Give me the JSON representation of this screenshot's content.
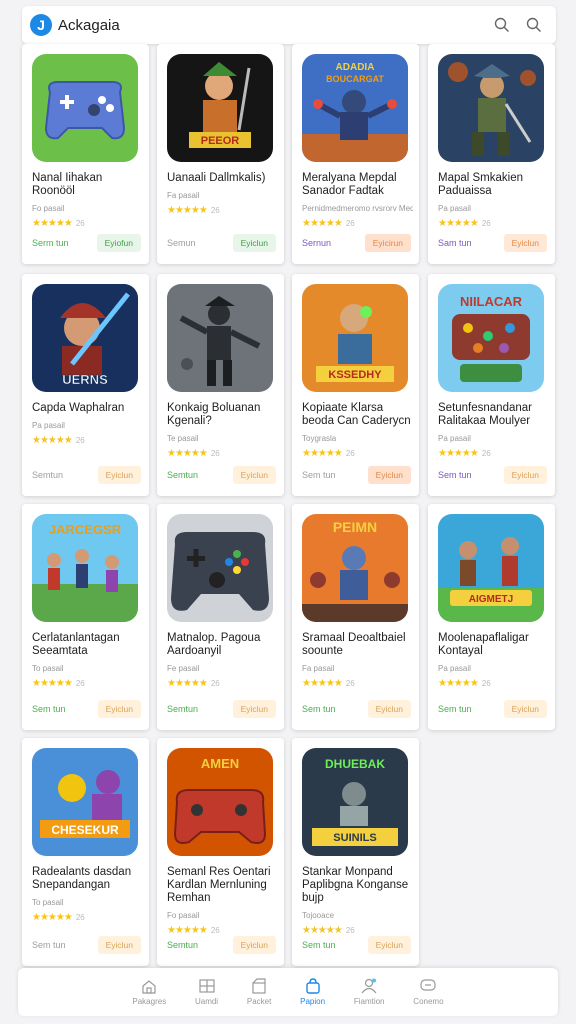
{
  "app": {
    "title": "Ackagaia"
  },
  "header": {
    "icons": [
      "search-icon",
      "search-icon"
    ]
  },
  "games": [
    {
      "name": "Nanal Iihakan Roonööl",
      "dev": "Fo pasail",
      "stars": "★★★★★",
      "count": "26",
      "left": "Serm tun",
      "right": "Eyiofun",
      "left_color": "#4caf50",
      "right_bg": "#e8f5e9",
      "right_color": "#43a047",
      "art": "controller-green"
    },
    {
      "name": "Uanaali Dallmkalis)",
      "dev": "Fa pasail",
      "stars": "★★★★★",
      "count": "26",
      "left": "Semun",
      "right": "Eyiclun",
      "left_color": "#9e9e9e",
      "right_bg": "#e8f5e9",
      "right_color": "#43a047",
      "art": "hero-dark"
    },
    {
      "name": "Meralyana Mepdal Sanador Fadtak",
      "dev": "Pernidmedmeromo rvsrorv Medrag",
      "stars": "★★★★★",
      "count": "26",
      "left": "Sernun",
      "right": "Eyicirun",
      "left_color": "#7e57c2",
      "right_bg": "#ffe0cc",
      "right_color": "#e08a4a",
      "art": "robot-battle"
    },
    {
      "name": "Mapal Smkakien Paduaissa",
      "dev": "Pa pasail",
      "stars": "★★★★★",
      "count": "26",
      "left": "Sam tun",
      "right": "Eyiclun",
      "left_color": "#7e57c2",
      "right_bg": "#ffe8d6",
      "right_color": "#e08a4a",
      "art": "warrior-blue"
    },
    {
      "name": "Capda Waphalran",
      "dev": "Pa pasail",
      "stars": "★★★★★",
      "count": "26",
      "left": "Semtun",
      "right": "Eyiclun",
      "left_color": "#9e9e9e",
      "right_bg": "#fff1dc",
      "right_color": "#d9a35a",
      "art": "knight-red"
    },
    {
      "name": "Konkaig Boluanan Kgenali?",
      "dev": "Te pasail",
      "stars": "★★★★★",
      "count": "26",
      "left": "Semtun",
      "right": "Eyiclun",
      "left_color": "#4caf50",
      "right_bg": "#fff1dc",
      "right_color": "#d9a35a",
      "art": "ninja-gray"
    },
    {
      "name": "Kopiaate Klarsa beoda Can Caderycn",
      "dev": "Toygrasla",
      "stars": "★★★★★",
      "count": "26",
      "left": "Sem tun",
      "right": "Eyiclun",
      "left_color": "#9e9e9e",
      "right_bg": "#ffe0cc",
      "right_color": "#e08a4a",
      "art": "hero-orange"
    },
    {
      "name": "Setunfesnandanar Ralitakaa Moulyer",
      "dev": "Pa pasail",
      "stars": "★★★★★",
      "count": "26",
      "left": "Sem tun",
      "right": "Eyiclun",
      "left_color": "#7e57c2",
      "right_bg": "#fff1dc",
      "right_color": "#d9a35a",
      "art": "board-blue"
    },
    {
      "name": "Cerlatanlantagan Seeamtata",
      "dev": "To pasail",
      "stars": "★★★★★",
      "count": "26",
      "left": "Sem tun",
      "right": "Eyiclun",
      "left_color": "#4caf50",
      "right_bg": "#fff1dc",
      "right_color": "#d9a35a",
      "art": "crowd-field"
    },
    {
      "name": "Matnalop. Pagoua Aardoanyil",
      "dev": "Fe pasail",
      "stars": "★★★★★",
      "count": "26",
      "left": "Semtun",
      "right": "Eyiclun",
      "left_color": "#4caf50",
      "right_bg": "#fff1dc",
      "right_color": "#d9a35a",
      "art": "controller-dark"
    },
    {
      "name": "Sramaal Deoaltbaiel soounte",
      "dev": "Fa pasail",
      "stars": "★★★★★",
      "count": "26",
      "left": "Sem tun",
      "right": "Eyiclun",
      "left_color": "#4caf50",
      "right_bg": "#fff1dc",
      "right_color": "#d9a35a",
      "art": "army-orange"
    },
    {
      "name": "Moolenapaflaligar Kontayal",
      "dev": "Pa pasail",
      "stars": "★★★★★",
      "count": "26",
      "left": "Sem tun",
      "right": "Eyiclun",
      "left_color": "#4caf50",
      "right_bg": "#fff1dc",
      "right_color": "#d9a35a",
      "art": "heroes-teal"
    },
    {
      "name": "Radealants dasdan Snepandangan",
      "dev": "To pasail",
      "stars": "★★★★★",
      "count": "26",
      "left": "Sem tun",
      "right": "Eyiclun",
      "left_color": "#9e9e9e",
      "right_bg": "#fff1dc",
      "right_color": "#d9a35a",
      "art": "purple-champ"
    },
    {
      "name": "Semanl Res Oentari Kardlan Mernluning Remhan",
      "dev": "Fo pasail",
      "stars": "★★★★★",
      "count": "26",
      "left": "Semtun",
      "right": "Eyiclun",
      "left_color": "#4caf50",
      "right_bg": "#fff1dc",
      "right_color": "#d9a35a",
      "art": "controller-red"
    },
    {
      "name": "Stankar Monpand Paplibgna Konganse bujp",
      "dev": "Tojooace",
      "stars": "★★★★★",
      "count": "26",
      "left": "Sem tun",
      "right": "Eyiclun",
      "left_color": "#4caf50",
      "right_bg": "#fff1dc",
      "right_color": "#d9a35a",
      "art": "robot-green"
    }
  ],
  "nav": [
    {
      "label": "Pakagres",
      "icon": "home-icon"
    },
    {
      "label": "Uamdi",
      "icon": "grid-icon"
    },
    {
      "label": "Packet",
      "icon": "box-icon"
    },
    {
      "label": "Papion",
      "icon": "bag-icon",
      "active": true
    },
    {
      "label": "Fiamtion",
      "icon": "user-icon"
    },
    {
      "label": "Conemo",
      "icon": "chat-icon"
    }
  ],
  "colors": {
    "accent": "#1e88e5",
    "text": "#222222",
    "muted": "#999999",
    "star": "#f5c518"
  }
}
